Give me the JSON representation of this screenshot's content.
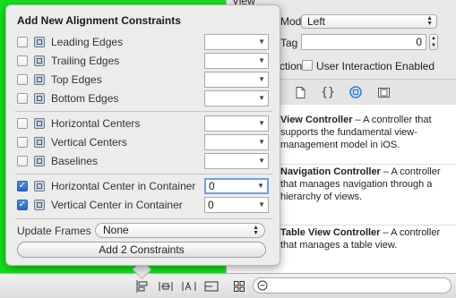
{
  "inspector": {
    "view_header": "View",
    "mode_label": "Mode",
    "mode_value": "Left",
    "tag_label": "Tag",
    "tag_value": "0",
    "interaction_label_prefix": "ction",
    "user_interaction_label": "User Interaction Enabled"
  },
  "library": {
    "items": [
      {
        "title": "View Controller",
        "desc": " – A controller that supports the fundamental view-management model in iOS."
      },
      {
        "title": "Navigation Controller",
        "desc": " – A controller that manages navigation through a hierarchy of views."
      },
      {
        "title": "Table View Controller",
        "desc": " – A controller that manages a table view."
      }
    ]
  },
  "popover": {
    "title": "Add New Alignment Constraints",
    "rows": [
      {
        "label": "Leading Edges",
        "checked": false,
        "value": ""
      },
      {
        "label": "Trailing Edges",
        "checked": false,
        "value": ""
      },
      {
        "label": "Top Edges",
        "checked": false,
        "value": ""
      },
      {
        "label": "Bottom Edges",
        "checked": false,
        "value": ""
      },
      {
        "label": "Horizontal Centers",
        "checked": false,
        "value": ""
      },
      {
        "label": "Vertical Centers",
        "checked": false,
        "value": ""
      },
      {
        "label": "Baselines",
        "checked": false,
        "value": ""
      },
      {
        "label": "Horizontal Center in Container",
        "checked": true,
        "value": "0"
      },
      {
        "label": "Vertical Center in Container",
        "checked": true,
        "value": "0"
      }
    ],
    "update_frames_label": "Update Frames",
    "update_frames_value": "None",
    "add_button": "Add 2 Constraints"
  },
  "colors": {
    "canvas": "#14e01b",
    "checkbox_on": "#2a68c8",
    "focus_ring": "#6aa0e6"
  }
}
